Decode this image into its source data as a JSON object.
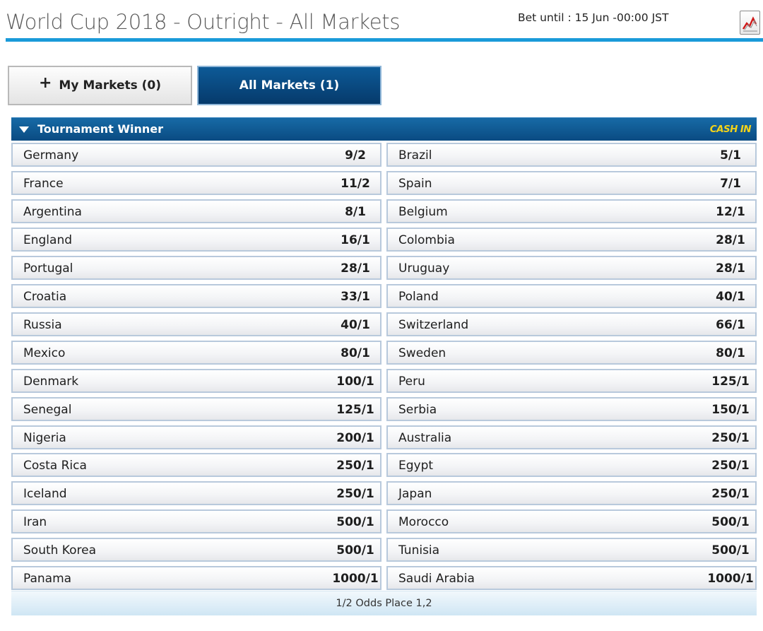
{
  "header": {
    "title": "World Cup 2018 - Outright - All Markets",
    "bet_until": "Bet until : 15 Jun -00:00 JST",
    "chart_icon": "chart-icon"
  },
  "tabs": {
    "my_markets_icon": "+",
    "my_markets_label": "My Markets (0)",
    "all_markets_label": "All Markets (1)"
  },
  "market": {
    "title": "Tournament Winner",
    "cash_in": "CASH IN",
    "rows": [
      [
        {
          "name": "Germany",
          "odds": "9/2"
        },
        {
          "name": "Brazil",
          "odds": "5/1"
        }
      ],
      [
        {
          "name": "France",
          "odds": "11/2"
        },
        {
          "name": "Spain",
          "odds": "7/1"
        }
      ],
      [
        {
          "name": "Argentina",
          "odds": "8/1"
        },
        {
          "name": "Belgium",
          "odds": "12/1"
        }
      ],
      [
        {
          "name": "England",
          "odds": "16/1"
        },
        {
          "name": "Colombia",
          "odds": "28/1"
        }
      ],
      [
        {
          "name": "Portugal",
          "odds": "28/1"
        },
        {
          "name": "Uruguay",
          "odds": "28/1"
        }
      ],
      [
        {
          "name": "Croatia",
          "odds": "33/1"
        },
        {
          "name": "Poland",
          "odds": "40/1"
        }
      ],
      [
        {
          "name": "Russia",
          "odds": "40/1"
        },
        {
          "name": "Switzerland",
          "odds": "66/1"
        }
      ],
      [
        {
          "name": "Mexico",
          "odds": "80/1"
        },
        {
          "name": "Sweden",
          "odds": "80/1"
        }
      ],
      [
        {
          "name": "Denmark",
          "odds": "100/1"
        },
        {
          "name": "Peru",
          "odds": "125/1"
        }
      ],
      [
        {
          "name": "Senegal",
          "odds": "125/1"
        },
        {
          "name": "Serbia",
          "odds": "150/1"
        }
      ],
      [
        {
          "name": "Nigeria",
          "odds": "200/1"
        },
        {
          "name": "Australia",
          "odds": "250/1"
        }
      ],
      [
        {
          "name": "Costa Rica",
          "odds": "250/1"
        },
        {
          "name": "Egypt",
          "odds": "250/1"
        }
      ],
      [
        {
          "name": "Iceland",
          "odds": "250/1"
        },
        {
          "name": "Japan",
          "odds": "250/1"
        }
      ],
      [
        {
          "name": "Iran",
          "odds": "500/1"
        },
        {
          "name": "Morocco",
          "odds": "500/1"
        }
      ],
      [
        {
          "name": "South Korea",
          "odds": "500/1"
        },
        {
          "name": "Tunisia",
          "odds": "500/1"
        }
      ],
      [
        {
          "name": "Panama",
          "odds": "1000/1"
        },
        {
          "name": "Saudi Arabia",
          "odds": "1000/1"
        }
      ]
    ],
    "footer": "1/2 Odds Place 1,2"
  },
  "colors": {
    "accent_rule": "#1a9ad9",
    "header_bar": "#0a4b82",
    "cash_in": "#f2d21a",
    "active_tab": "#063a6b"
  }
}
